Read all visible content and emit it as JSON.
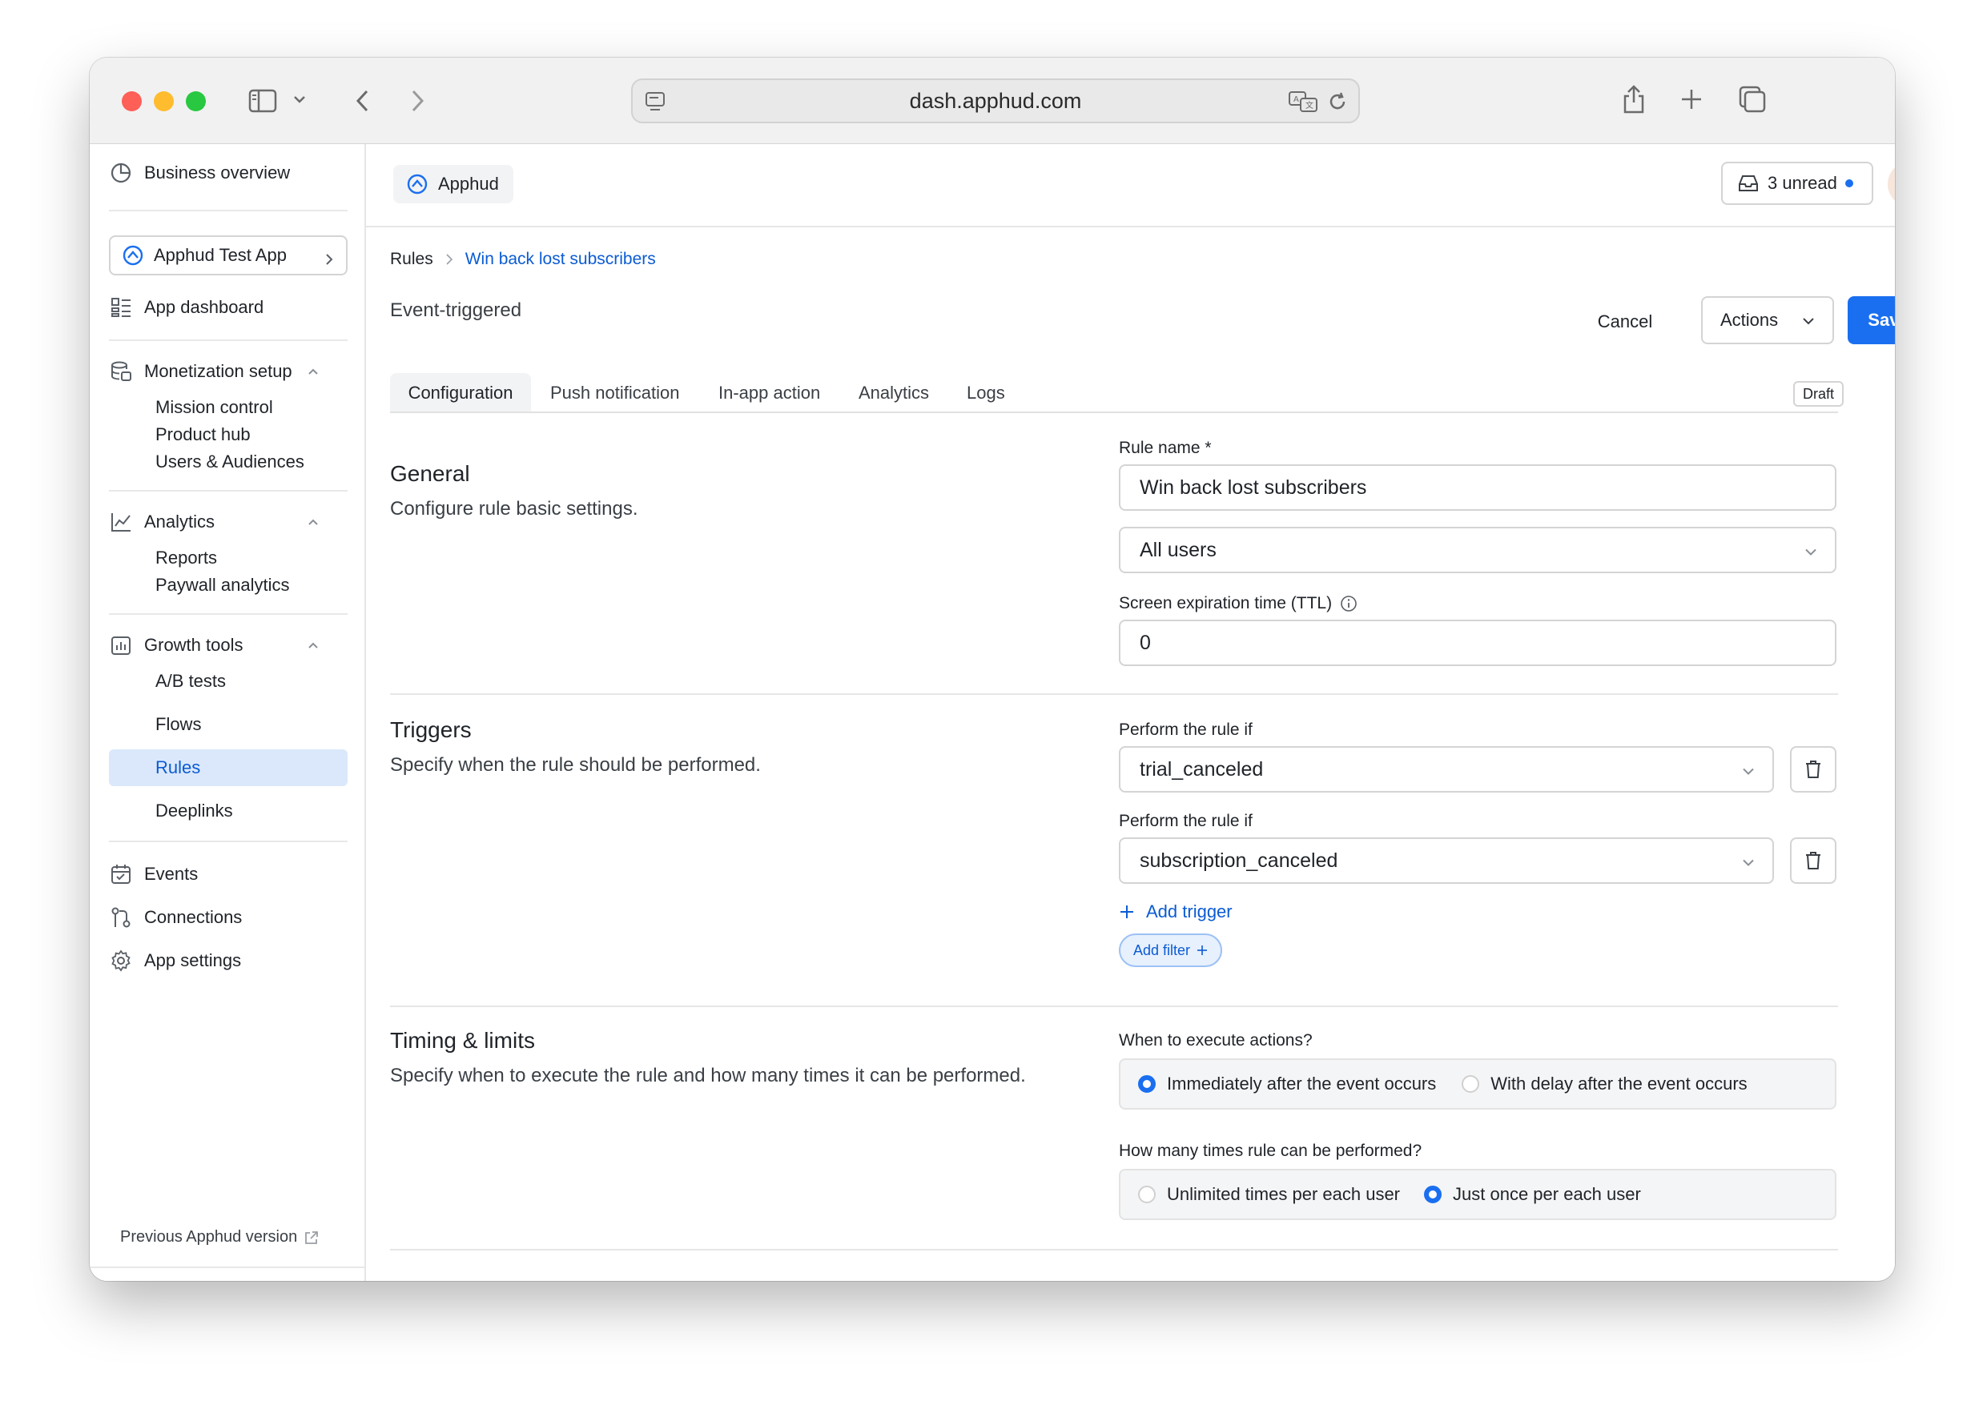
{
  "browser": {
    "url": "dash.apphud.com"
  },
  "sidebar": {
    "business_overview": "Business overview",
    "app_selector": "Apphud Test App",
    "app_dashboard": "App dashboard",
    "monetization": {
      "label": "Monetization setup",
      "items": [
        "Mission control",
        "Product hub",
        "Users & Audiences"
      ]
    },
    "analytics": {
      "label": "Analytics",
      "items": [
        "Reports",
        "Paywall analytics"
      ]
    },
    "growth": {
      "label": "Growth tools",
      "items": [
        "A/B tests",
        "Flows",
        "Rules",
        "Deeplinks"
      ],
      "active": "Rules"
    },
    "events": "Events",
    "connections": "Connections",
    "app_settings": "App settings",
    "previous_version": "Previous Apphud version"
  },
  "topbar": {
    "brand": "Apphud",
    "unread": "3 unread"
  },
  "breadcrumb": {
    "root": "Rules",
    "current": "Win back lost subscribers"
  },
  "page": {
    "subtitle": "Event-triggered",
    "cancel": "Cancel",
    "actions": "Actions",
    "save": "Save",
    "status": "Draft"
  },
  "tabs": [
    "Configuration",
    "Push notification",
    "In-app action",
    "Analytics",
    "Logs"
  ],
  "general": {
    "title": "General",
    "description": "Configure rule basic settings.",
    "rule_name_label": "Rule name *",
    "rule_name_value": "Win back lost subscribers",
    "audience_value": "All users",
    "ttl_label": "Screen expiration time (TTL)",
    "ttl_value": "0"
  },
  "triggers": {
    "title": "Triggers",
    "description": "Specify when the rule should be performed.",
    "items": [
      {
        "label": "Perform the rule if",
        "value": "trial_canceled"
      },
      {
        "label": "Perform the rule if",
        "value": "subscription_canceled"
      }
    ],
    "add_trigger": "Add trigger",
    "add_filter": "Add filter"
  },
  "timing": {
    "title": "Timing & limits",
    "description": "Specify when to execute the rule and how many times it can be performed.",
    "execute_label": "When to execute actions?",
    "execute_options": [
      {
        "label": "Immediately after the event occurs",
        "selected": true
      },
      {
        "label": "With delay after the event occurs",
        "selected": false
      }
    ],
    "times_label": "How many times rule can be performed?",
    "times_options": [
      {
        "label": "Unlimited times per each user",
        "selected": false
      },
      {
        "label": "Just once per each user",
        "selected": true
      }
    ]
  },
  "colors": {
    "accent": "#1a6ff0",
    "active_bg": "#dbe8fb",
    "link": "#0b5bd3"
  }
}
